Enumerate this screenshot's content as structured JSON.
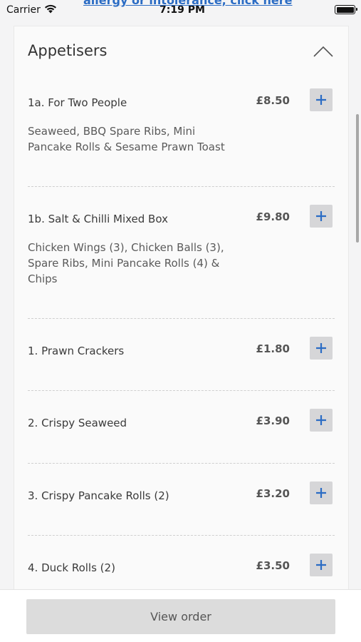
{
  "status_bar": {
    "carrier": "Carrier",
    "time": "7:19 PM"
  },
  "allergy_link": "allergy or intolerance, click here",
  "section": {
    "title": "Appetisers"
  },
  "items": [
    {
      "name": "1a. For Two People",
      "price": "£8.50",
      "description": "Seaweed, BBQ Spare Ribs, Mini Pancake Rolls & Sesame Prawn Toast"
    },
    {
      "name": "1b. Salt & Chilli Mixed Box",
      "price": "£9.80",
      "description": "Chicken Wings (3), Chicken Balls (3), Spare Ribs, Mini Pancake Rolls (4) & Chips"
    },
    {
      "name": "1. Prawn Crackers",
      "price": "£1.80"
    },
    {
      "name": "2. Crispy Seaweed",
      "price": "£3.90"
    },
    {
      "name": "3. Crispy Pancake Rolls (2)",
      "price": "£3.20"
    },
    {
      "name": "4. Duck Rolls (2)",
      "price": "£3.50"
    }
  ],
  "view_order_label": "View order",
  "colors": {
    "accent": "#2b6cc4",
    "button_bg": "#d6d6d8"
  }
}
